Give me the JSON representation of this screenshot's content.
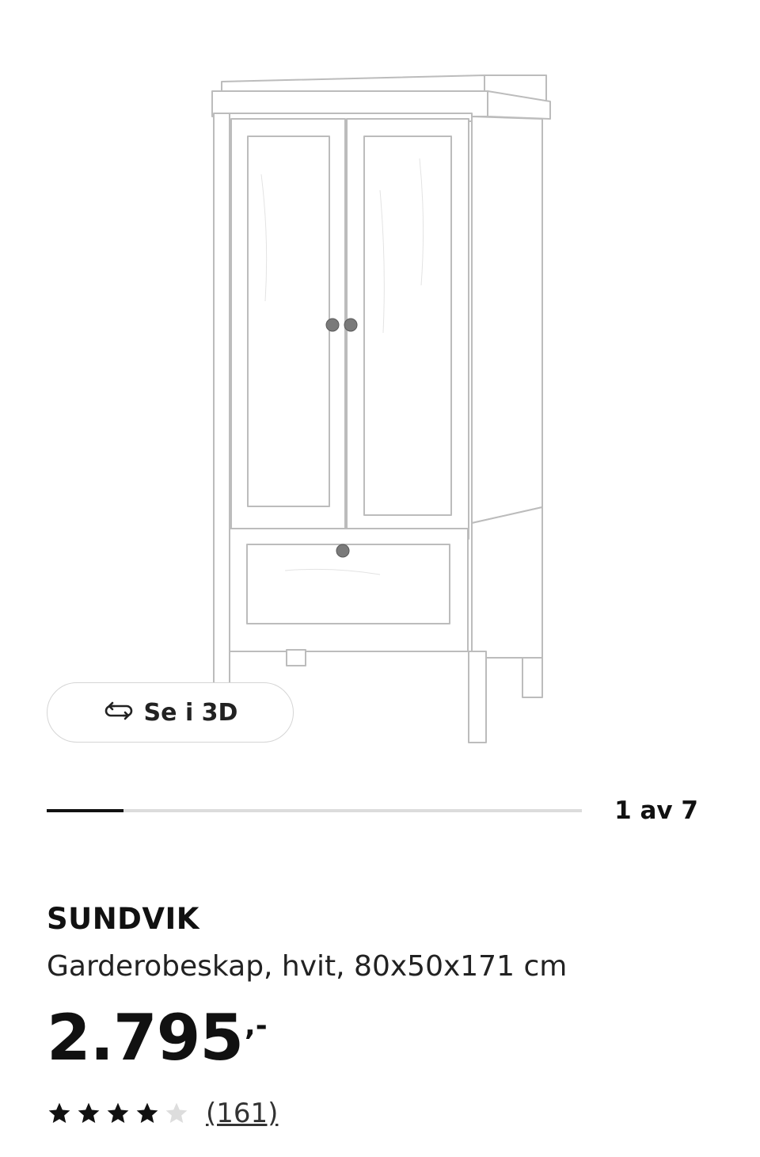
{
  "product": {
    "image_alt": "SUNDVIK Garderobeskap, hvit",
    "view_3d_label": "Se i 3D",
    "view_3d_icon": "rotate-3d-icon",
    "gallery": {
      "counter": "1 av 7",
      "current": 1,
      "total": 7
    },
    "name": "SUNDVIK",
    "description": "Garderobeskap, hvit, 80x50x171 cm",
    "price": {
      "integer": "2.795",
      "suffix": ",-"
    },
    "rating": {
      "value": 4,
      "max": 5,
      "reviews": "(161)"
    }
  },
  "colors": {
    "text": "#111111",
    "star_filled": "#111111",
    "star_empty": "#dddddd",
    "progress_track": "#dcdcdc",
    "progress_fill": "#111111"
  }
}
